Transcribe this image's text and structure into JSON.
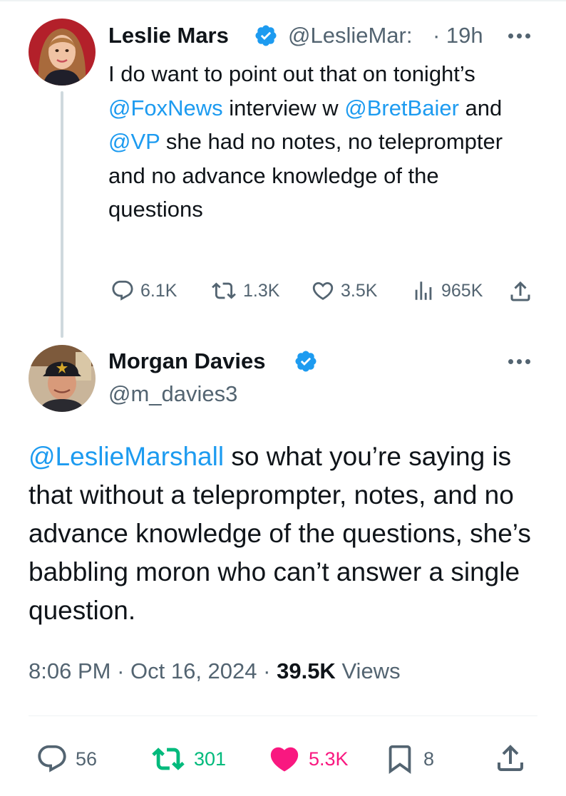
{
  "tweet1": {
    "author_name": "Leslie Mars",
    "handle": "@LeslieMar:",
    "time": "· 19h",
    "text_parts": {
      "p1": "I do want to point out that on tonight’s ",
      "m1": "@FoxNews",
      "p2": " interview w ",
      "m2": "@BretBaier",
      "p3": " and ",
      "m3": "@VP",
      "p4": " she had no notes, no teleprompter and no advance knowledge of the questions"
    },
    "stats": {
      "replies": "6.1K",
      "reposts": "1.3K",
      "likes": "3.5K",
      "views": "965K"
    }
  },
  "tweet2": {
    "author_name": "Morgan Davies",
    "handle": "@m_davies3",
    "text_parts": {
      "m1": "@LeslieMarshall",
      "p1": " so what you’re saying is that without a teleprompter, notes, and no advance knowledge of the questions, she’s babbling moron who can’t answer a single question."
    },
    "time": "8:06 PM",
    "separator": " · ",
    "date": "Oct 16, 2024",
    "views_count": "39.5K",
    "views_label": " Views",
    "stats": {
      "replies": "56",
      "reposts": "301",
      "likes": "5.3K",
      "bookmarks": "8"
    }
  },
  "colors": {
    "accent": "#1d9bf0",
    "repost": "#00ba7c",
    "like": "#f91880",
    "muted": "#536471"
  },
  "icons": [
    "verified-badge-icon",
    "more-icon",
    "reply-icon",
    "repost-icon",
    "like-icon",
    "views-icon",
    "share-icon",
    "bookmark-icon"
  ]
}
